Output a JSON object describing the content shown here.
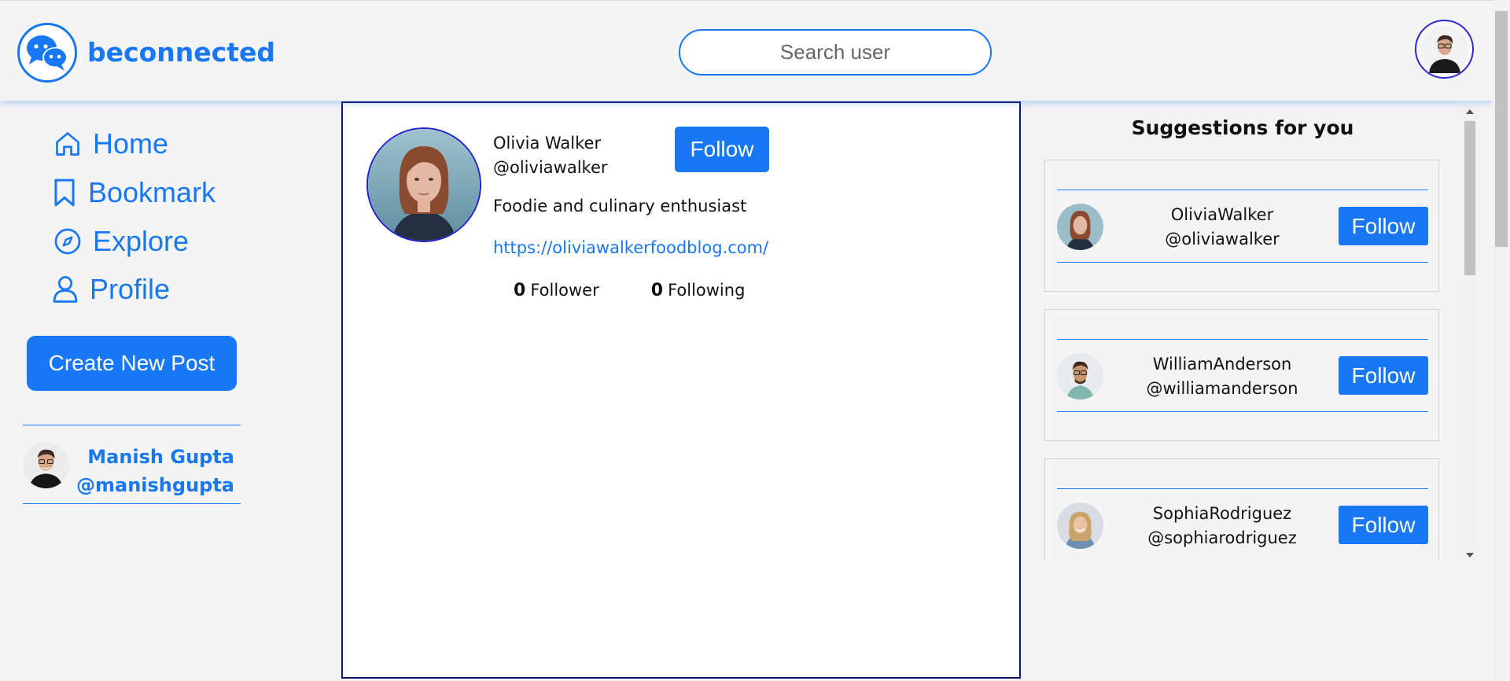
{
  "header": {
    "brand": "beconnected",
    "search_placeholder": "Search user"
  },
  "sidebar": {
    "nav": [
      {
        "label": "Home",
        "icon": "home-icon"
      },
      {
        "label": "Bookmark",
        "icon": "bookmark-icon"
      },
      {
        "label": "Explore",
        "icon": "compass-icon"
      },
      {
        "label": "Profile",
        "icon": "user-icon"
      }
    ],
    "create_button": "Create New Post",
    "current_user": {
      "name": "Manish Gupta",
      "handle": "@manishgupta"
    }
  },
  "profile": {
    "name": "Olivia Walker",
    "handle": "@oliviawalker",
    "follow_label": "Follow",
    "bio": "Foodie and culinary enthusiast",
    "link": "https://oliviawalkerfoodblog.com/",
    "followers_count": "0",
    "followers_label": "Follower",
    "following_count": "0",
    "following_label": "Following"
  },
  "suggestions": {
    "title": "Suggestions for you",
    "items": [
      {
        "name": "OliviaWalker",
        "handle": "@oliviawalker",
        "follow_label": "Follow"
      },
      {
        "name": "WilliamAnderson",
        "handle": "@williamanderson",
        "follow_label": "Follow"
      },
      {
        "name": "SophiaRodriguez",
        "handle": "@sophiarodriguez",
        "follow_label": "Follow"
      }
    ]
  },
  "colors": {
    "accent": "#1877f2",
    "panel_border": "#0a1670"
  }
}
